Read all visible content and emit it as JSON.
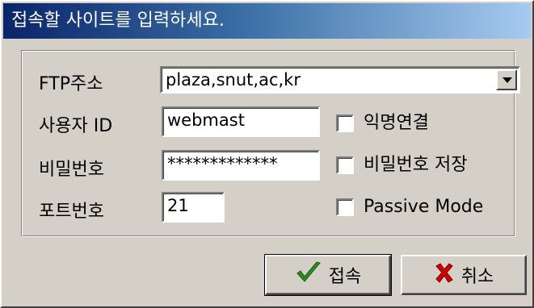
{
  "window": {
    "title": "접속할 사이트를 입력하세요."
  },
  "form": {
    "ftp_address_label": "FTP주소",
    "ftp_address_value": "plaza,snut,ac,kr",
    "user_id_label": "사용자 ID",
    "user_id_value": "webmast",
    "password_label": "비밀번호",
    "password_value": "*************",
    "port_label": "포트번호",
    "port_value": "21",
    "anonymous_label": "익명연결",
    "anonymous_checked": false,
    "save_password_label": "비밀번호 저장",
    "save_password_checked": false,
    "passive_mode_label": "Passive Mode",
    "passive_mode_checked": false
  },
  "buttons": {
    "connect_label": "접속",
    "cancel_label": "취소"
  },
  "colors": {
    "title_start": "#0a246a",
    "title_end": "#a6caf0",
    "dialog_face": "#d4d0c8",
    "check_icon": "#2e8b1f",
    "cancel_icon": "#cc0000"
  },
  "icons": {
    "connect": "checkmark-icon",
    "cancel": "x-icon"
  }
}
